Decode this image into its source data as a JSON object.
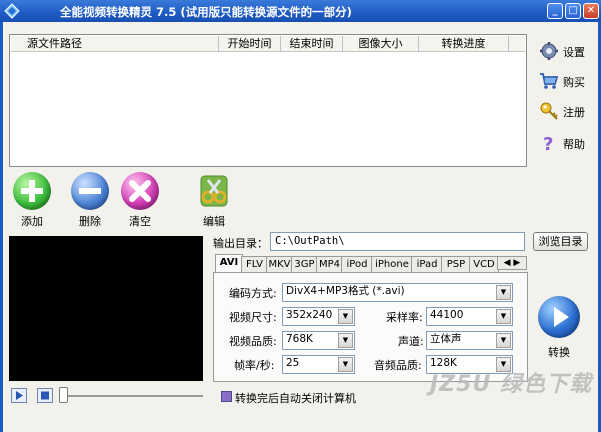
{
  "window": {
    "title": "全能视频转换精灵 7.5 (试用版只能转换源文件的一部分)",
    "minimize": "_",
    "maximize": "□",
    "close": "✕"
  },
  "file_list": {
    "columns": [
      "源文件路径",
      "开始时间",
      "结束时间",
      "图像大小",
      "转换进度"
    ]
  },
  "side_buttons": {
    "settings": "设置",
    "buy": "购买",
    "register": "注册",
    "help": "帮助"
  },
  "actions": {
    "add": "添加",
    "delete": "删除",
    "clear": "清空",
    "edit": "编辑"
  },
  "output": {
    "label": "输出目录：",
    "path": "C:\\OutPath\\",
    "browse": "浏览目录"
  },
  "tabs": [
    "AVI",
    "FLV",
    "MKV",
    "3GP",
    "MP4",
    "iPod",
    "iPhone",
    "iPad",
    "PSP",
    "VCD"
  ],
  "tab_scroll": "◀ ▶",
  "settings": {
    "codec_label": "编码方式:",
    "codec_value": "DivX4+MP3格式 (*.avi)",
    "size_label": "视频尺寸:",
    "size_value": "352x240",
    "samplerate_label": "采样率:",
    "samplerate_value": "44100",
    "quality_label": "视频品质:",
    "quality_value": "768K",
    "channel_label": "声道:",
    "channel_value": "立体声",
    "fps_label": "帧率/秒:",
    "fps_value": "25",
    "audio_quality_label": "音频品质:",
    "audio_quality_value": "128K"
  },
  "convert_label": "转换",
  "auto_shutdown_label": "转换完后自动关闭计算机",
  "watermark": "JZ5U 绿色下载",
  "colors": {
    "titlebar": "#1d5bc4",
    "add": "#3fbf3f",
    "delete": "#4f86d8",
    "clear": "#d23fb5",
    "convert": "#2c6fd1"
  }
}
